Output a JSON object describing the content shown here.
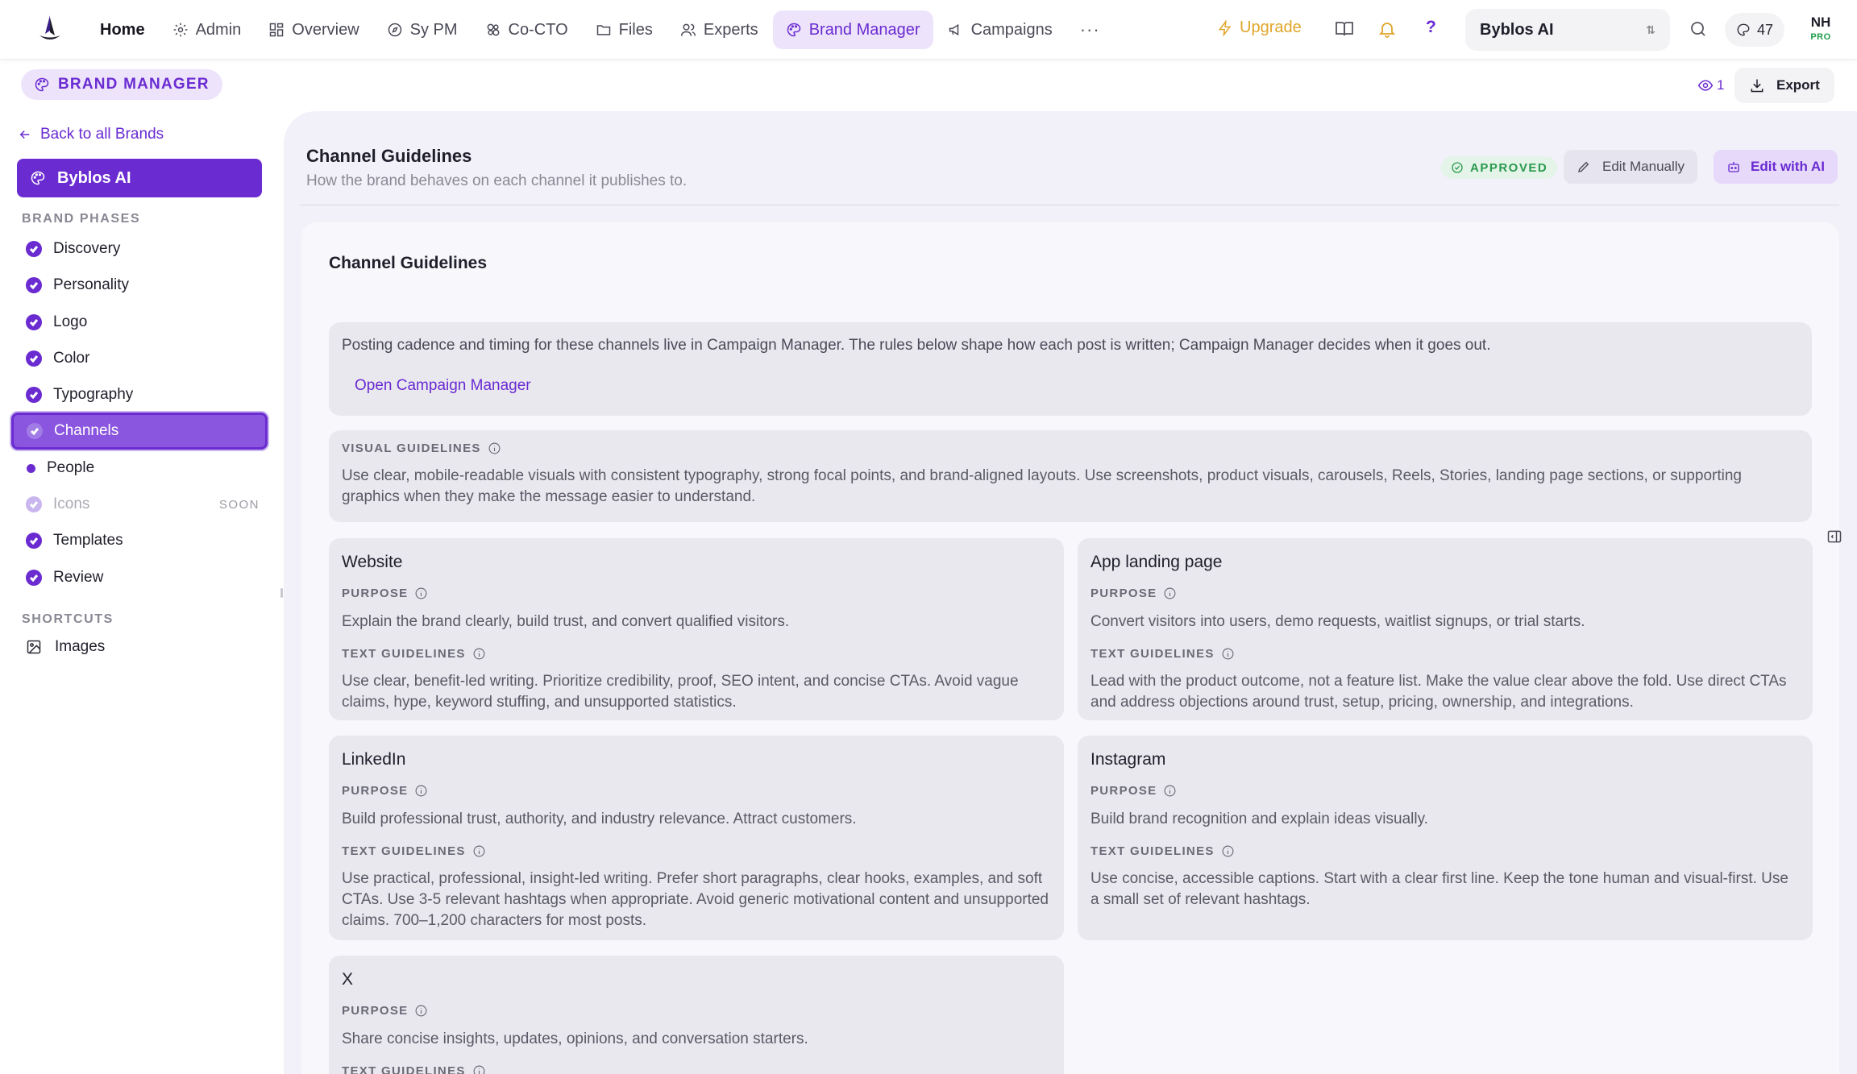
{
  "nav": {
    "home": "Home",
    "admin": "Admin",
    "overview": "Overview",
    "sypm": "Sy PM",
    "cocto": "Co-CTO",
    "files": "Files",
    "experts": "Experts",
    "brand_manager": "Brand Manager",
    "campaigns": "Campaigns",
    "more": "···",
    "upgrade": "Upgrade",
    "help": "?",
    "workspace": "Byblos AI",
    "credits": "47",
    "avatar_initials": "NH",
    "avatar_badge": "PRO"
  },
  "subheader": {
    "section_badge": "BRAND MANAGER",
    "viewers": "1",
    "export": "Export"
  },
  "sidebar": {
    "back": "Back to all Brands",
    "brand": "Byblos AI",
    "phases_label": "BRAND PHASES",
    "phases": [
      {
        "label": "Discovery"
      },
      {
        "label": "Personality"
      },
      {
        "label": "Logo"
      },
      {
        "label": "Color"
      },
      {
        "label": "Typography"
      },
      {
        "label": "Channels"
      },
      {
        "label": "People"
      },
      {
        "label": "Icons",
        "tag": "SOON"
      },
      {
        "label": "Templates"
      },
      {
        "label": "Review"
      }
    ],
    "shortcuts_label": "SHORTCUTS",
    "shortcuts": [
      {
        "label": "Images"
      }
    ]
  },
  "panel": {
    "title": "Channel Guidelines",
    "subtitle": "How the brand behaves on each channel it publishes to.",
    "status": "APPROVED",
    "edit_manually": "Edit Manually",
    "edit_ai": "Edit with AI",
    "card_title": "Channel Guidelines",
    "info_text": "Posting cadence and timing for these channels live in Campaign Manager. The rules below shape how each post is written; Campaign Manager decides when it goes out.",
    "info_link": "Open Campaign Manager",
    "visual_label": "VISUAL GUIDELINES",
    "visual_text": "Use clear, mobile-readable visuals with consistent typography, strong focal points, and brand-aligned layouts. Use screenshots, product visuals, carousels, Reels, Stories, landing page sections, or supporting graphics when they make the message easier to understand.",
    "purpose_label": "PURPOSE",
    "text_label": "TEXT GUIDELINES"
  },
  "channels": [
    {
      "name": "Website",
      "purpose": "Explain the brand clearly, build trust, and convert qualified visitors.",
      "text": "Use clear, benefit-led writing. Prioritize credibility, proof, SEO intent, and concise CTAs. Avoid vague claims, hype, keyword stuffing, and unsupported statistics."
    },
    {
      "name": "App landing page",
      "purpose": "Convert visitors into users, demo requests, waitlist signups, or trial starts.",
      "text": "Lead with the product outcome, not a feature list. Make the value clear above the fold. Use direct CTAs and address objections around trust, setup, pricing, ownership, and integrations."
    },
    {
      "name": "LinkedIn",
      "purpose": "Build professional trust, authority, and industry relevance. Attract customers.",
      "text": "Use practical, professional, insight-led writing. Prefer short paragraphs, clear hooks, examples, and soft CTAs. Use 3-5 relevant hashtags when appropriate. Avoid generic motivational content and unsupported claims. 700–1,200 characters for most posts."
    },
    {
      "name": "Instagram",
      "purpose": "Build brand recognition and explain ideas visually.",
      "text": "Use concise, accessible captions. Start with a clear first line. Keep the tone human and visual-first. Use a small set of relevant hashtags."
    },
    {
      "name": "X",
      "purpose": "Share concise insights, updates, opinions, and conversation starters."
    }
  ]
}
